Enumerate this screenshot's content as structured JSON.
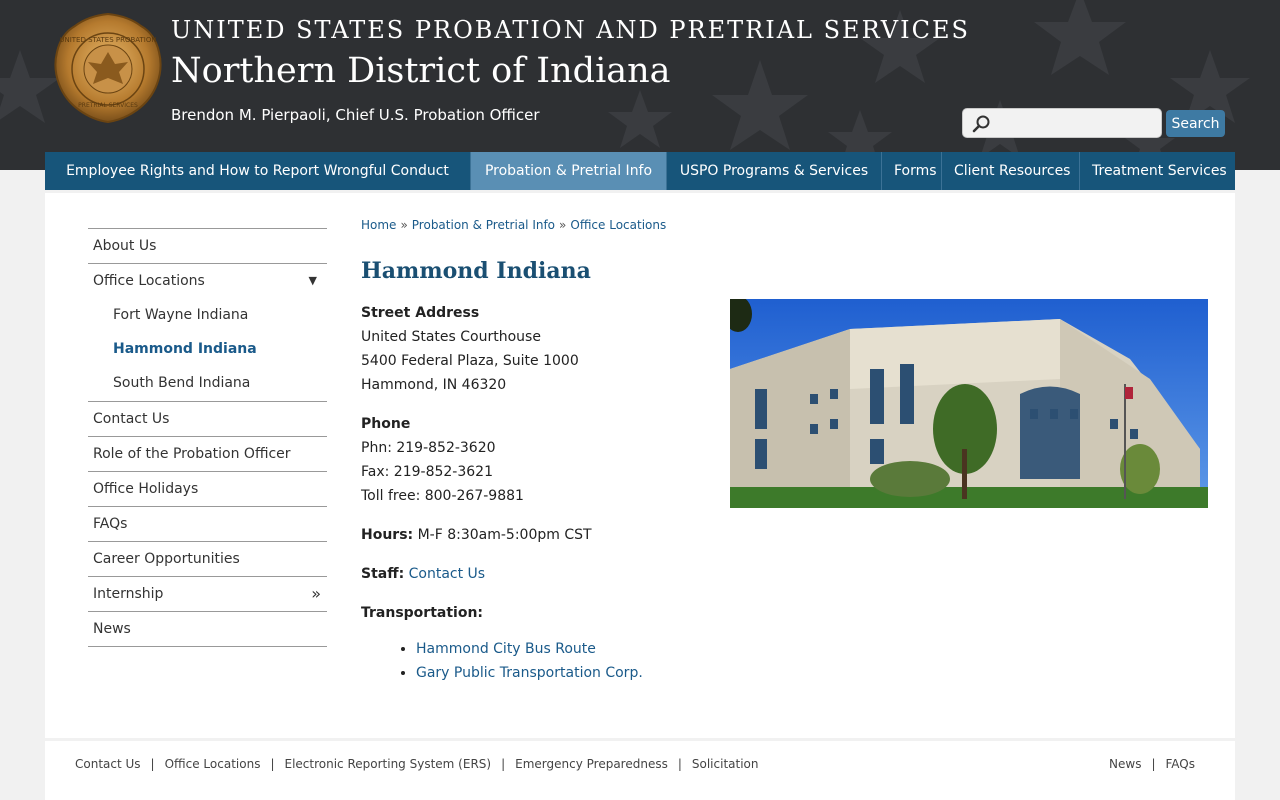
{
  "header": {
    "agency": "UNITED STATES PROBATION AND PRETRIAL SERVICES",
    "district": "Northern District of Indiana",
    "chief": "Brendon M. Pierpaoli, Chief U.S. Probation Officer",
    "seal_top_text": "UNITED STATES PROBATION",
    "seal_bottom_text": "PRETRIAL SERVICES",
    "search_placeholder": "",
    "search_button": "Search"
  },
  "nav": [
    {
      "label": "Employee Rights and How to Report Wrongful Conduct"
    },
    {
      "label": "Probation & Pretrial Info",
      "active": true
    },
    {
      "label": "USPO Programs & Services"
    },
    {
      "label": "Forms"
    },
    {
      "label": "Client Resources"
    },
    {
      "label": "Treatment Services"
    }
  ],
  "sidebar": {
    "about": "About Us",
    "office_locations": "Office Locations",
    "sub": [
      "Fort Wayne Indiana",
      "Hammond Indiana",
      "South Bend Indiana"
    ],
    "contact": "Contact Us",
    "role": "Role of the Probation Officer",
    "holidays": "Office Holidays",
    "faqs": "FAQs",
    "careers": "Career Opportunities",
    "internship": "Internship",
    "news": "News",
    "expand_arrow": "▼",
    "more_arrow": "»"
  },
  "breadcrumb": {
    "home": "Home",
    "section": "Probation & Pretrial Info",
    "page": "Office Locations",
    "sep": "»"
  },
  "main": {
    "title": "Hammond Indiana",
    "street_label": "Street Address",
    "street_1": "United States Courthouse",
    "street_2": "5400 Federal Plaza, Suite 1000",
    "street_3": "Hammond, IN  46320",
    "phone_label": "Phone",
    "phone": "Phn: 219-852-3620",
    "fax": "Fax: 219-852-3621",
    "tollfree": "Toll free: 800-267-9881",
    "hours_label": "Hours:",
    "hours": " M-F  8:30am-5:00pm CST",
    "staff_label": "Staff:",
    "staff_link": "Contact Us",
    "transport_label": "Transportation:",
    "transport_links": [
      "Hammond City Bus Route",
      "Gary Public Transportation Corp."
    ]
  },
  "footer": {
    "left": [
      "Contact Us",
      "Office Locations",
      "Electronic Reporting System (ERS)",
      "Emergency Preparedness",
      "Solicitation"
    ],
    "right": [
      "News",
      "FAQs"
    ],
    "sep": "|"
  },
  "colors": {
    "header_bg": "#2e3033",
    "nav_bg": "#17557a",
    "nav_active": "#5a8fb4",
    "link": "#1a5a8a",
    "title": "#1a4f72"
  }
}
